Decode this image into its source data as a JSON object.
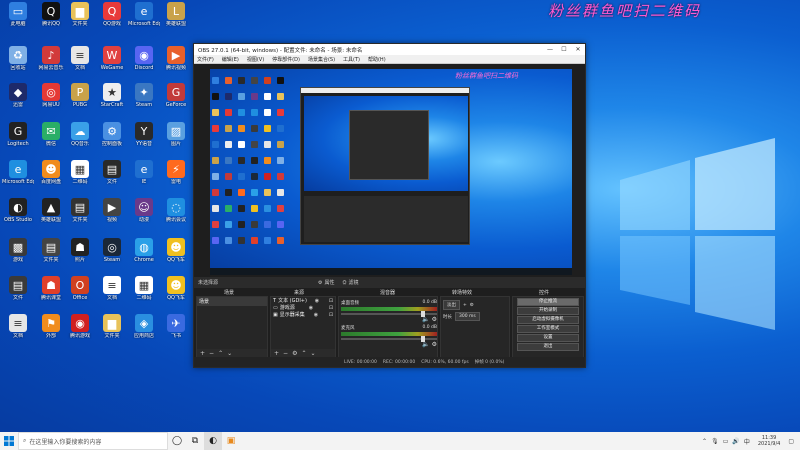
{
  "desktop": {
    "watermark": "粉丝群鱼吧扫二维码",
    "icons": [
      {
        "label": "此电脑",
        "icon": "computer-icon",
        "color": "#2f7fe0",
        "glyph": "▭"
      },
      {
        "label": "腾讯QQ",
        "icon": "qq-icon",
        "color": "#111111",
        "glyph": "Q"
      },
      {
        "label": "文件夹",
        "icon": "folder-icon",
        "color": "#e8c25a",
        "glyph": "▆"
      },
      {
        "label": "QQ游戏",
        "icon": "qq-game-icon",
        "color": "#e83a3a",
        "glyph": "Q"
      },
      {
        "label": "Microsoft Edge",
        "icon": "browser-icon",
        "color": "#1f6fd0",
        "glyph": "e"
      },
      {
        "label": "英雄联盟",
        "icon": "league-icon",
        "color": "#c9a24a",
        "glyph": "L"
      },
      {
        "label": "回收站",
        "icon": "recycle-bin-icon",
        "color": "#7fb0e6",
        "glyph": "♻"
      },
      {
        "label": "网易云音乐",
        "icon": "music-icon",
        "color": "#d23a3a",
        "glyph": "♪"
      },
      {
        "label": "文档",
        "icon": "document-icon",
        "color": "#e6e6e6",
        "glyph": "≡"
      },
      {
        "label": "WeGame",
        "icon": "game-icon",
        "color": "#e04040",
        "glyph": "W"
      },
      {
        "label": "Discord",
        "icon": "discord-icon",
        "color": "#5865f2",
        "glyph": "◉"
      },
      {
        "label": "腾讯视频",
        "icon": "video-icon",
        "color": "#e8602c",
        "glyph": "▶"
      },
      {
        "label": "迅雷",
        "icon": "app-icon",
        "color": "#1e2a6a",
        "glyph": "◆"
      },
      {
        "label": "网易UU",
        "icon": "netease-icon",
        "color": "#e53935",
        "glyph": "◎"
      },
      {
        "label": "PUBG",
        "icon": "pubg-icon",
        "color": "#c9a24a",
        "glyph": "P"
      },
      {
        "label": "StarCraft",
        "icon": "star-icon",
        "color": "#eeeeee",
        "glyph": "★"
      },
      {
        "label": "Steam",
        "icon": "app-icon",
        "color": "#3a77c2",
        "glyph": "✦"
      },
      {
        "label": "GeForce",
        "icon": "game-icon",
        "color": "#c23a3a",
        "glyph": "G"
      },
      {
        "label": "Logitech",
        "icon": "logitech-icon",
        "color": "#222222",
        "glyph": "G"
      },
      {
        "label": "微信",
        "icon": "wechat-icon",
        "color": "#2aae67",
        "glyph": "✉"
      },
      {
        "label": "QQ音乐",
        "icon": "cloud-icon",
        "color": "#3aa0e8",
        "glyph": "☁"
      },
      {
        "label": "控制面板",
        "icon": "control-panel-icon",
        "color": "#4a90e2",
        "glyph": "⚙"
      },
      {
        "label": "YY语音",
        "icon": "app-icon",
        "color": "#2a2a2a",
        "glyph": "Y"
      },
      {
        "label": "图片",
        "icon": "image-icon",
        "color": "#5aa0e0",
        "glyph": "▨"
      },
      {
        "label": "Microsoft Edge",
        "icon": "edge-icon",
        "color": "#1f8fe0",
        "glyph": "e"
      },
      {
        "label": "百度网盘",
        "icon": "app-icon",
        "color": "#f08c1e",
        "glyph": "☻"
      },
      {
        "label": "二维码",
        "icon": "qr-code-icon",
        "color": "#ffffff",
        "glyph": "▦"
      },
      {
        "label": "文件",
        "icon": "file-icon",
        "color": "#2a2a2a",
        "glyph": "▤"
      },
      {
        "label": "IE",
        "icon": "ie-icon",
        "color": "#1f6fd0",
        "glyph": "e"
      },
      {
        "label": "雷电",
        "icon": "app-icon",
        "color": "#ff6a1e",
        "glyph": "⚡"
      },
      {
        "label": "OBS Studio",
        "icon": "obs-icon",
        "color": "#222222",
        "glyph": "◐"
      },
      {
        "label": "英雄联盟",
        "icon": "league-icon",
        "color": "#222222",
        "glyph": "▲"
      },
      {
        "label": "文件夹",
        "icon": "folder-icon",
        "color": "#333333",
        "glyph": "▤"
      },
      {
        "label": "视频",
        "icon": "video-icon",
        "color": "#444444",
        "glyph": "▶"
      },
      {
        "label": "动漫",
        "icon": "anime-icon",
        "color": "#6a3a8a",
        "glyph": "☺"
      },
      {
        "label": "腾讯会议",
        "icon": "app-icon",
        "color": "#1f8fe0",
        "glyph": "◌"
      },
      {
        "label": "游戏",
        "icon": "game-icon",
        "color": "#3a3a3a",
        "glyph": "▩"
      },
      {
        "label": "文件夹",
        "icon": "folder-icon",
        "color": "#444444",
        "glyph": "▤"
      },
      {
        "label": "照片",
        "icon": "photo-icon",
        "color": "#222222",
        "glyph": "☗"
      },
      {
        "label": "Steam",
        "icon": "steam-icon",
        "color": "#1b2838",
        "glyph": "◎"
      },
      {
        "label": "Chrome",
        "icon": "chrome-icon",
        "color": "#2aa0e8",
        "glyph": "◍"
      },
      {
        "label": "QQ飞车",
        "icon": "app-icon",
        "color": "#f0c020",
        "glyph": "☻"
      },
      {
        "label": "文件",
        "icon": "file-icon",
        "color": "#3a3a3a",
        "glyph": "▤"
      },
      {
        "label": "腾讯课堂",
        "icon": "app-icon",
        "color": "#e0402a",
        "glyph": "☗"
      },
      {
        "label": "Office",
        "icon": "office-icon",
        "color": "#d04020",
        "glyph": "O"
      },
      {
        "label": "文档",
        "icon": "document-icon",
        "color": "#ffffff",
        "glyph": "≡"
      },
      {
        "label": "二维码",
        "icon": "qr-code-icon",
        "color": "#ffffff",
        "glyph": "▦"
      },
      {
        "label": "QQ飞车",
        "icon": "app-icon",
        "color": "#f0c020",
        "glyph": "☻"
      },
      {
        "label": "文档",
        "icon": "document-icon",
        "color": "#e6e6e6",
        "glyph": "≡"
      },
      {
        "label": "外部",
        "icon": "app-icon",
        "color": "#f08c1e",
        "glyph": "⚑"
      },
      {
        "label": "腾讯游戏",
        "icon": "app-icon",
        "color": "#d02020",
        "glyph": "◉"
      },
      {
        "label": "文件夹",
        "icon": "folder-icon",
        "color": "#e8c25a",
        "glyph": "▆"
      },
      {
        "label": "应用商店",
        "icon": "store-icon",
        "color": "#2a8fe0",
        "glyph": "◈"
      },
      {
        "label": "飞书",
        "icon": "app-icon",
        "color": "#3a6ae0",
        "glyph": "✈"
      }
    ]
  },
  "obs": {
    "title": "OBS 27.0.1 (64-bit, windows) - 配置文件: 未命名 - 场景: 未命名",
    "minimize": "—",
    "maximize": "☐",
    "close": "✕",
    "menu": [
      "文件(F)",
      "编辑(E)",
      "视图(V)",
      "停靠部件(D)",
      "场景集合(S)",
      "工具(T)",
      "帮助(H)"
    ],
    "preview_watermark": "粉丝群鱼吧扫二维码",
    "toolbar_label": "未选择源",
    "toolbar_properties": "属性",
    "toolbar_filters": "滤镜",
    "docks": {
      "scenes_header": "场景",
      "sources_header": "来源",
      "mixer_header": "混音器",
      "transitions_header": "转场特效",
      "controls_header": "控件"
    },
    "scenes": [
      "场景"
    ],
    "sources": [
      {
        "name": "文本 (GDI+)",
        "icon": "text-icon"
      },
      {
        "name": "游戏源",
        "icon": "game-capture-icon"
      },
      {
        "name": "显示器采集",
        "icon": "monitor-icon"
      }
    ],
    "mixer": [
      {
        "name": "桌面音频",
        "level": "0.0 dB"
      },
      {
        "name": "麦克风",
        "level": "0.0 dB"
      }
    ],
    "transition": {
      "type": "淡出",
      "duration_label": "时长",
      "duration": "300 ms"
    },
    "controls": [
      "停止推流",
      "开始录制",
      "启动虚拟摄像机",
      "工作室模式",
      "设置",
      "退出"
    ],
    "status": {
      "live": "LIVE: 00:00:00",
      "rec": "REC: 00:00:00",
      "cpu": "CPU: 0.6%, 60.00 fps",
      "dropped": "掉帧 0 (0.0%)"
    }
  },
  "taskbar": {
    "search_placeholder": "在这里输入你要搜索的内容",
    "time": "11:39",
    "date": "2021/9/4"
  }
}
